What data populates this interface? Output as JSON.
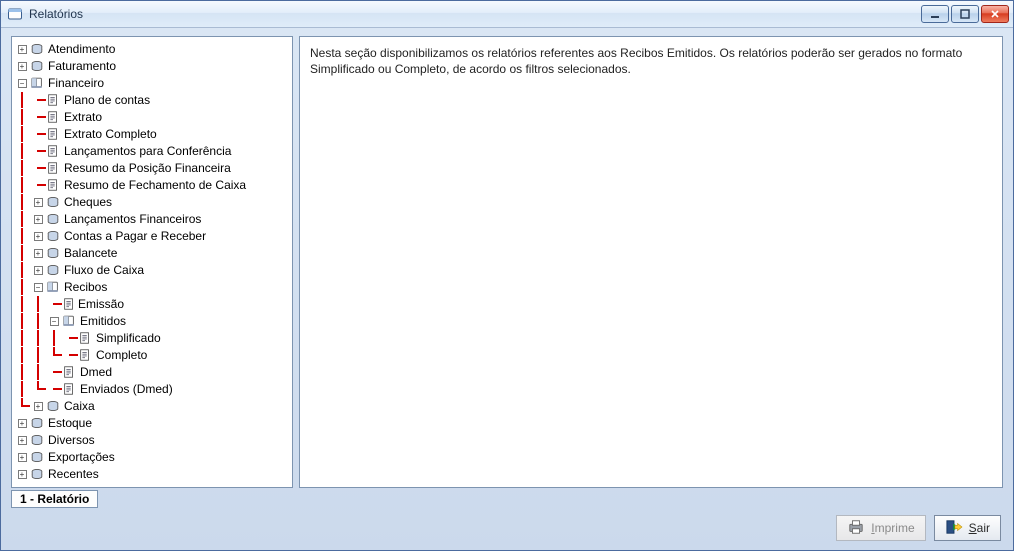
{
  "window": {
    "title": "Relatórios"
  },
  "description": "Nesta seção disponibilizamos os relatórios referentes aos Recibos Emitidos. Os relatórios poderão ser gerados no formato Simplificado ou Completo, de acordo os filtros selecionados.",
  "tab": {
    "label": "1 - Relatório"
  },
  "buttons": {
    "print": {
      "label": "Imprime",
      "accel": "I",
      "rest": "mprime"
    },
    "exit": {
      "label": "Sair",
      "accel": "S",
      "rest": "air"
    }
  },
  "tree": {
    "atendimento": "Atendimento",
    "faturamento": "Faturamento",
    "financeiro": "Financeiro",
    "financeiro_children": {
      "plano_de_contas": "Plano de contas",
      "extrato": "Extrato",
      "extrato_completo": "Extrato Completo",
      "lancamentos_conferencia": "Lançamentos para Conferência",
      "resumo_posicao": "Resumo da Posição Financeira",
      "resumo_fechamento": "Resumo de Fechamento de Caixa",
      "cheques": "Cheques",
      "lancamentos_financeiros": "Lançamentos Financeiros",
      "contas_pagar_receber": "Contas a Pagar e Receber",
      "balancete": "Balancete",
      "fluxo_caixa": "Fluxo de Caixa",
      "recibos": "Recibos",
      "recibos_children": {
        "emissao": "Emissão",
        "emitidos": "Emitidos",
        "emitidos_children": {
          "simplificado": "Simplificado",
          "completo": "Completo"
        },
        "dmed": "Dmed",
        "enviados_dmed": "Enviados (Dmed)"
      },
      "caixa": "Caixa"
    },
    "estoque": "Estoque",
    "diversos": "Diversos",
    "exportacoes": "Exportações",
    "recentes": "Recentes"
  }
}
